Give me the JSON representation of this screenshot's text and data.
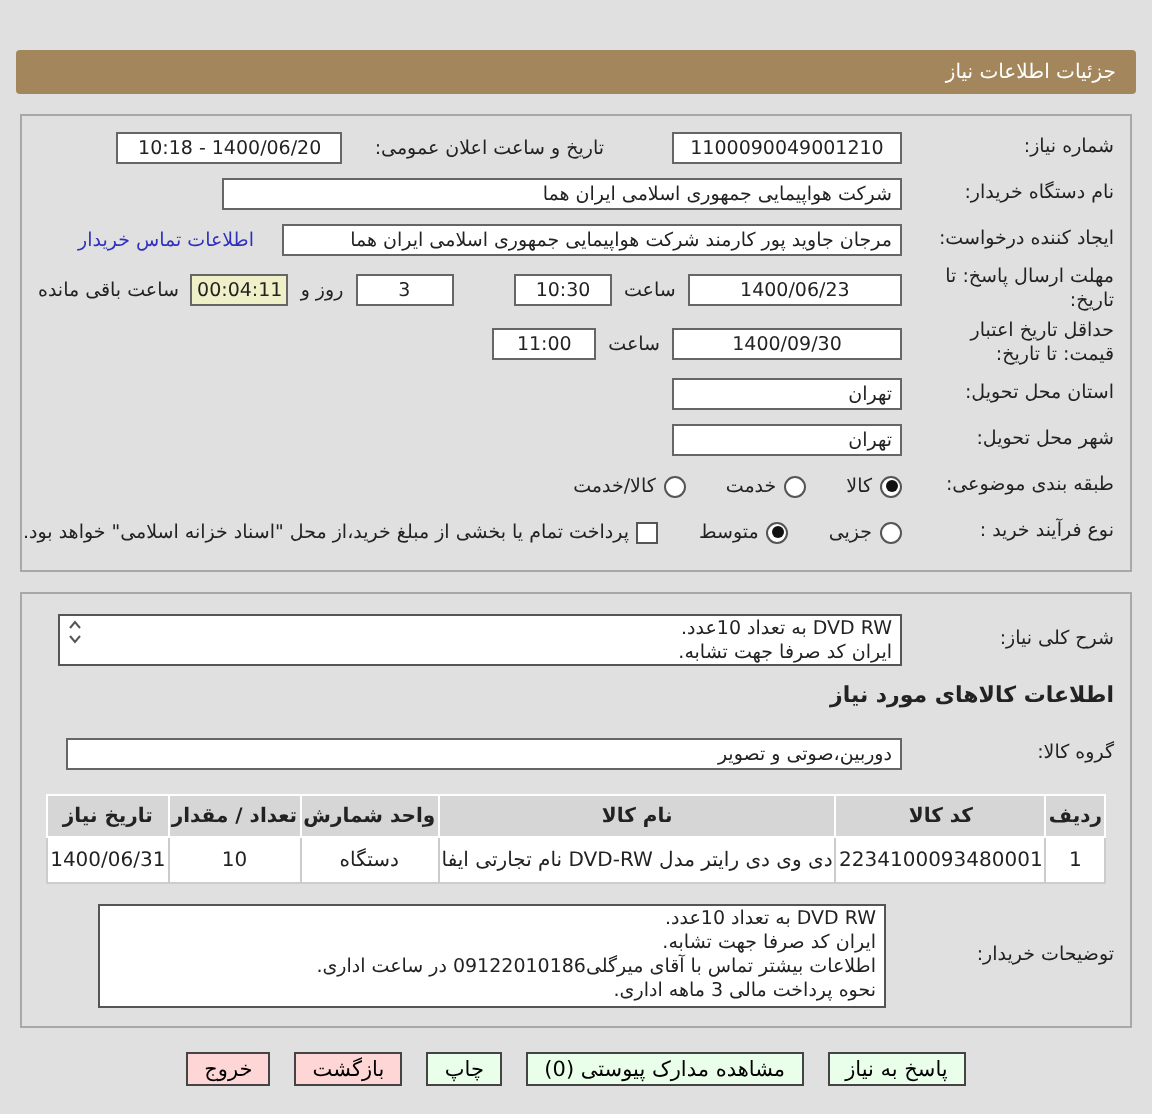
{
  "header": {
    "title": "جزئیات اطلاعات نیاز"
  },
  "need_number": {
    "label": "شماره نیاز:",
    "value": "1100090049001210"
  },
  "announce": {
    "label": "تاریخ و ساعت اعلان عمومی:",
    "value": "1400/06/20 - 10:18"
  },
  "buyer": {
    "label": "نام دستگاه خریدار:",
    "value": "شرکت هواپیمایی جمهوری اسلامی ایران هما"
  },
  "creator": {
    "label": "ایجاد کننده درخواست:",
    "value": "مرجان جاوید پور کارمند شرکت هواپیمایی جمهوری اسلامی ایران هما",
    "link": "اطلاعات تماس خریدار"
  },
  "deadline": {
    "label": "مهلت ارسال پاسخ: تا تاریخ:",
    "date": "1400/06/23",
    "time_label": "ساعت",
    "time": "10:30",
    "days": "3",
    "days_label": "روز و",
    "remaining": "00:04:11",
    "remaining_label": "ساعت باقی مانده"
  },
  "validity": {
    "label": "حداقل تاریخ اعتبار قیمت: تا تاریخ:",
    "date": "1400/09/30",
    "time_label": "ساعت",
    "time": "11:00"
  },
  "province": {
    "label": "استان محل تحویل:",
    "value": "تهران"
  },
  "city": {
    "label": "شهر محل تحویل:",
    "value": "تهران"
  },
  "category": {
    "label": "طبقه بندی موضوعی:",
    "options": [
      {
        "label": "کالا",
        "selected": true
      },
      {
        "label": "خدمت",
        "selected": false
      },
      {
        "label": "کالا/خدمت",
        "selected": false
      }
    ]
  },
  "process": {
    "label": "نوع فرآیند خرید :",
    "options": [
      {
        "label": "جزیی",
        "selected": false
      },
      {
        "label": "متوسط",
        "selected": true
      }
    ],
    "payment": {
      "label": "پرداخت تمام یا بخشی از مبلغ خرید،از محل \"اسناد خزانه اسلامی\" خواهد بود.",
      "checked": false
    }
  },
  "description": {
    "label": "شرح کلی نیاز:",
    "lines": [
      "DVD RW به تعداد 10عدد.",
      "ایران کد صرفا جهت تشابه."
    ]
  },
  "goods_title": "اطلاعات کالاهای مورد نیاز",
  "group": {
    "label": "گروه کالا:",
    "value": "دوربین،صوتی و تصویر"
  },
  "table": {
    "columns": [
      "ردیف",
      "کد کالا",
      "نام کالا",
      "واحد شمارش",
      "تعداد / مقدار",
      "تاریخ نیاز"
    ],
    "rows": [
      [
        "1",
        "2234100093480001",
        "دی وی دی رایتر مدل DVD-RW نام تجارتی ایفا",
        "دستگاه",
        "10",
        "1400/06/31"
      ]
    ]
  },
  "buyer_notes": {
    "label": "توضیحات خریدار:",
    "lines": [
      "DVD RW به تعداد 10عدد.",
      "ایران کد صرفا جهت تشابه.",
      "اطلاعات بیشتر تماس با آقای میرگلی09122010186 در ساعت اداری.",
      "نحوه پرداخت مالی 3 ماهه اداری."
    ]
  },
  "buttons": [
    {
      "label": "پاسخ به نیاز",
      "kind": "primary"
    },
    {
      "label": "مشاهده مدارک پیوستی (0)",
      "kind": "primary"
    },
    {
      "label": "چاپ",
      "kind": "primary"
    },
    {
      "label": "بازگشت",
      "kind": "danger"
    },
    {
      "label": "خروج",
      "kind": "danger"
    }
  ]
}
